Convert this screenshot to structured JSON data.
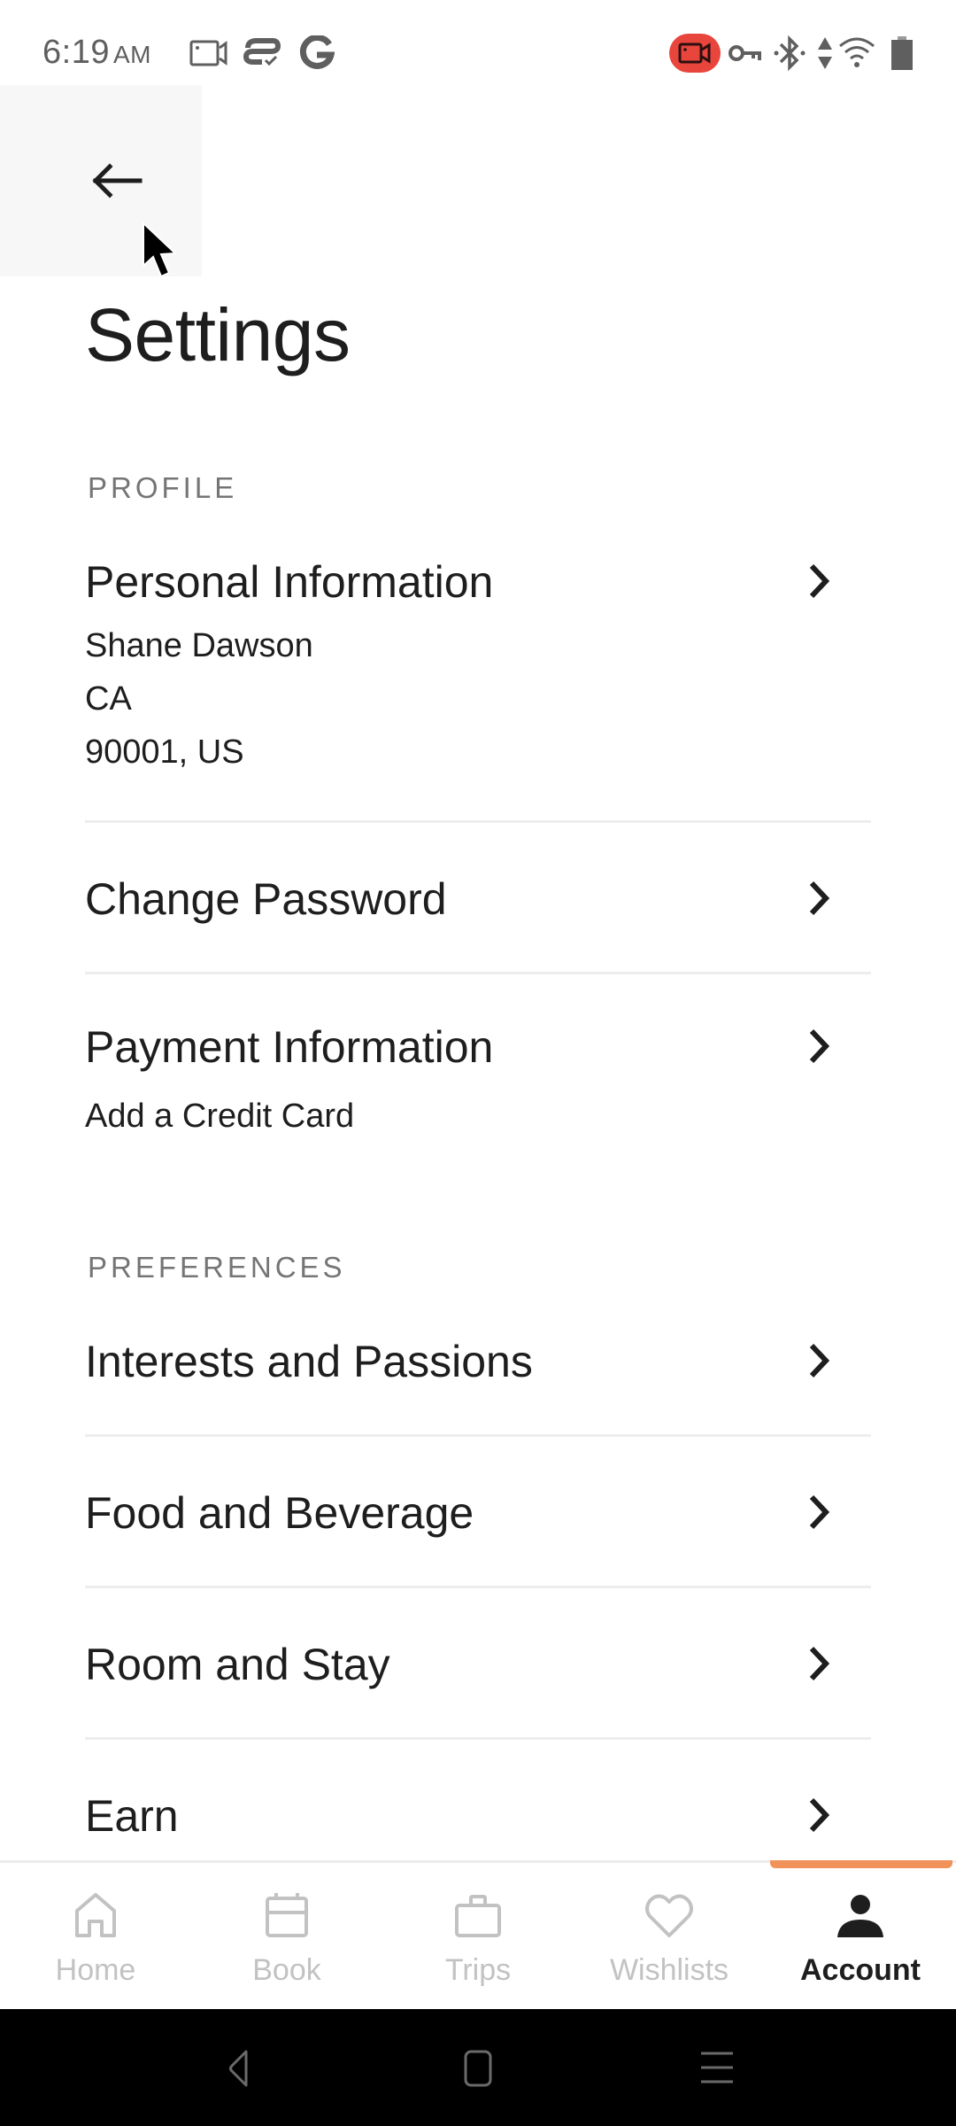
{
  "status_bar": {
    "time": "6:19",
    "ampm": "AM",
    "left_icons": [
      "screen-record-icon",
      "cloud-sync-icon",
      "google-icon"
    ],
    "right_icons": [
      "recording-active-icon",
      "vpn-key-icon",
      "bluetooth-icon",
      "data-transfer-icon",
      "wifi-icon",
      "battery-icon"
    ],
    "recording_color": "#e8453c"
  },
  "header": {
    "back_icon": "arrow-left-icon",
    "title": "Settings"
  },
  "sections": [
    {
      "header": "PROFILE",
      "items": [
        {
          "title": "Personal Information",
          "subtitles": [
            "Shane Dawson",
            "CA",
            "90001, US"
          ]
        },
        {
          "title": "Change Password",
          "subtitles": []
        },
        {
          "title": "Payment Information",
          "subtitles": [
            "Add a Credit Card"
          ]
        }
      ]
    },
    {
      "header": "PREFERENCES",
      "items": [
        {
          "title": "Interests and Passions",
          "subtitles": []
        },
        {
          "title": "Food and Beverage",
          "subtitles": []
        },
        {
          "title": "Room and Stay",
          "subtitles": []
        },
        {
          "title": "Earn",
          "subtitles": []
        }
      ]
    }
  ],
  "bottom_nav": {
    "accent_color": "#f0925a",
    "items": [
      {
        "label": "Home",
        "icon": "home-icon",
        "active": false
      },
      {
        "label": "Book",
        "icon": "calendar-icon",
        "active": false
      },
      {
        "label": "Trips",
        "icon": "briefcase-icon",
        "active": false
      },
      {
        "label": "Wishlists",
        "icon": "heart-icon",
        "active": false
      },
      {
        "label": "Account",
        "icon": "person-icon",
        "active": true
      }
    ]
  },
  "system_nav": {
    "buttons": [
      "back-icon",
      "home-square-icon",
      "recents-icon"
    ]
  }
}
